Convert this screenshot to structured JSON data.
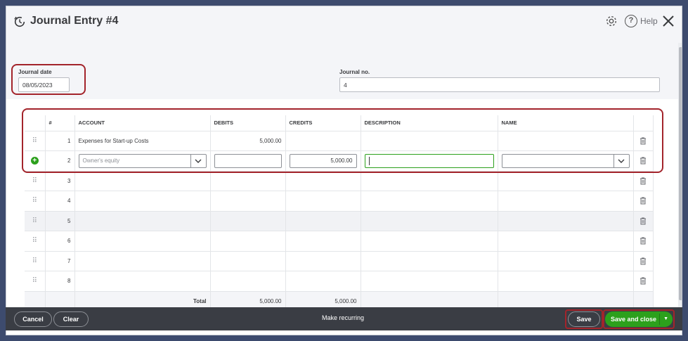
{
  "header": {
    "title": "Journal Entry #4",
    "help_label": "Help"
  },
  "form": {
    "journal_date_label": "Journal date",
    "journal_date_value": "08/05/2023",
    "journal_no_label": "Journal no.",
    "journal_no_value": "4"
  },
  "table": {
    "columns": {
      "num": "#",
      "account": "ACCOUNT",
      "debits": "DEBITS",
      "credits": "CREDITS",
      "description": "DESCRIPTION",
      "name": "NAME"
    },
    "rows": [
      {
        "num": "1",
        "account": "Expenses for Start-up Costs",
        "debits": "5,000.00",
        "credits": ""
      },
      {
        "num": "2",
        "account_placeholder": "Owner's equity",
        "debits": "",
        "credits": "5,000.00",
        "description": "",
        "name": ""
      },
      {
        "num": "3"
      },
      {
        "num": "4"
      },
      {
        "num": "5"
      },
      {
        "num": "6"
      },
      {
        "num": "7"
      },
      {
        "num": "8"
      }
    ],
    "total_label": "Total",
    "total_debits": "5,000.00",
    "total_credits": "5,000.00"
  },
  "footer": {
    "cancel_label": "Cancel",
    "clear_label": "Clear",
    "make_recurring_label": "Make recurring",
    "save_label": "Save",
    "save_close_label": "Save and close"
  },
  "colors": {
    "accent_green": "#2ca01c",
    "highlight_red": "#a3242b",
    "footer_bg": "#3a3d44"
  }
}
